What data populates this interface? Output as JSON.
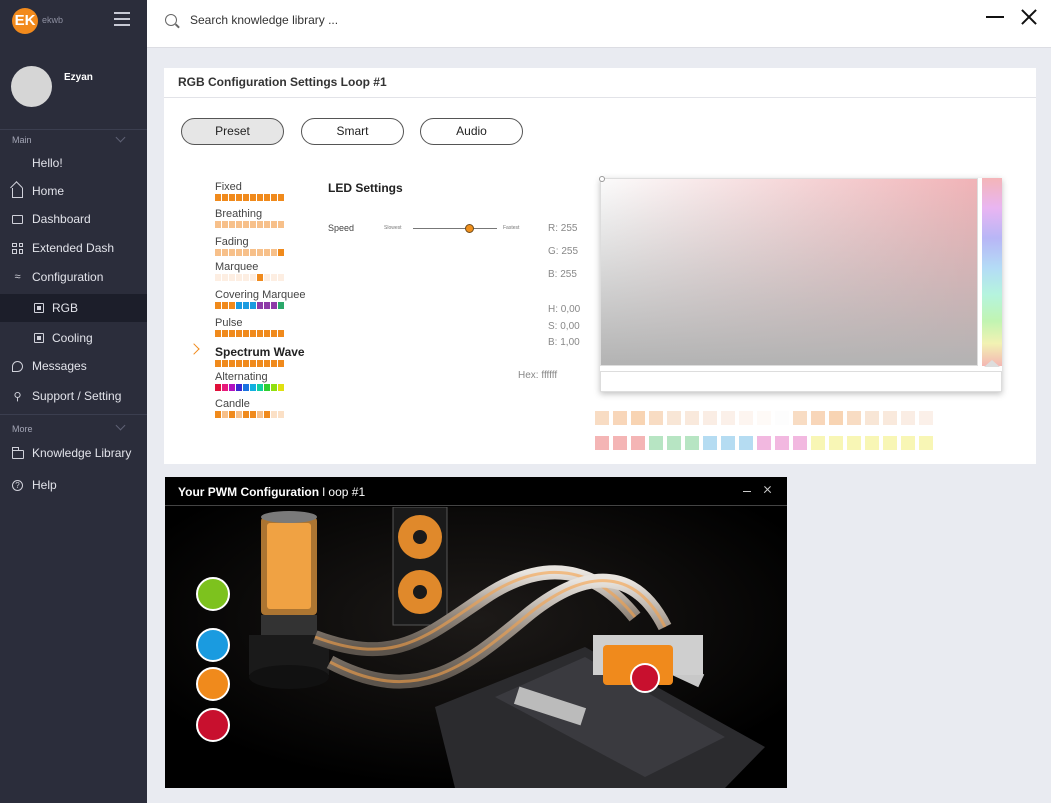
{
  "app": {
    "logo_text": "ekwb",
    "logo_glyph": "EK"
  },
  "user": {
    "name": "Ezyan"
  },
  "sidebar": {
    "sections": [
      {
        "label": "Main"
      },
      {
        "label": "More"
      }
    ],
    "items": [
      {
        "label": "Hello!",
        "icon": "none"
      },
      {
        "label": "Home",
        "icon": "home-icon"
      },
      {
        "label": "Dashboard",
        "icon": "dashboard-icon"
      },
      {
        "label": "Extended Dash",
        "icon": "grid-icon"
      },
      {
        "label": "Configuration",
        "icon": "configuration-icon"
      },
      {
        "label": "RGB",
        "icon": "rgb-icon"
      },
      {
        "label": "Cooling",
        "icon": "cooling-icon"
      },
      {
        "label": "Messages",
        "icon": "message-icon"
      },
      {
        "label": "Support / Setting",
        "icon": "support-icon"
      },
      {
        "label": "Knowledge Library",
        "icon": "folder-icon"
      },
      {
        "label": "Help",
        "icon": "help-icon"
      }
    ]
  },
  "search": {
    "placeholder": "Search knowledge library ..."
  },
  "rgb": {
    "title": "RGB Configuration Settings Loop #1",
    "modes": [
      "Preset",
      "Smart",
      "Audio"
    ],
    "active_mode": "Preset",
    "effects": [
      "Fixed",
      "Breathing",
      "Fading",
      "Marquee",
      "Covering Marquee",
      "Pulse",
      "Spectrum Wave",
      "Alternating",
      "Candle"
    ],
    "selected_effect": "Spectrum Wave",
    "led": {
      "title": "LED Settings",
      "speed_label": "Speed",
      "slowest": "Slowest",
      "fastest": "Fastest",
      "speed_value_fraction": 0.68
    },
    "values": {
      "r": "R: 255",
      "g": "G: 255",
      "b": "B: 255",
      "h": "H: 0,00",
      "s": "S: 0,00",
      "bv": "B: 1,00",
      "hex": "Hex: ffffff"
    },
    "colors": {
      "accent": "#f08a1c",
      "selected_color": "#ffffff"
    }
  },
  "pwm": {
    "title_bold": "Your PWM Configuration",
    "title_rest": " l oop #1",
    "buttons": [
      {
        "name": "pump-settings-icon",
        "color": "#7dc21e"
      },
      {
        "name": "reservoir-icon",
        "color": "#1a9be0"
      },
      {
        "name": "radiator-icon",
        "color": "#f08a1c"
      },
      {
        "name": "cpu-block-icon",
        "color": "#c8102e"
      }
    ]
  }
}
